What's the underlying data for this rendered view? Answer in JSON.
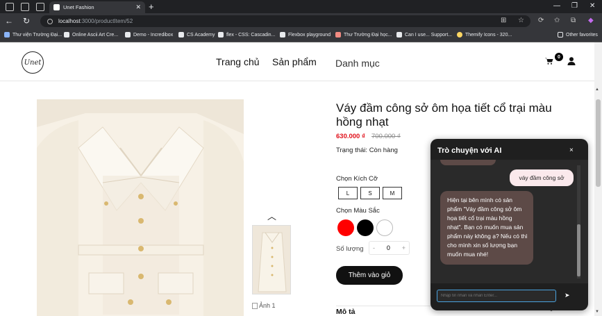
{
  "browser": {
    "tab_title": "Unet Fashion",
    "url_host": "localhost",
    "url_path": ":3000/productItem/52",
    "bookmarks": [
      "Thư viện Trường Đại...",
      "Online Ascii Art Cre...",
      "Demo - Incredibox",
      "CS Academy",
      "flex - CSS: Cascadin...",
      "Flexbox playground",
      "Thư Trường Đại học...",
      "Can I use... Support...",
      "Themify Icons - 320..."
    ],
    "other_favorites": "Other favorites"
  },
  "header": {
    "logo_text": "Unet",
    "nav": [
      "Trang chủ",
      "Sản phẩm",
      "Danh mục"
    ],
    "cart_count": "0"
  },
  "product": {
    "title": "Váy đầm công sở ôm họa tiết cổ trại màu hồng nhạt",
    "price": "630.000 ₫",
    "old_price": "700.000 ₫",
    "status": "Trạng thái: Còn hàng",
    "size_label": "Chọn Kích Cỡ",
    "sizes": [
      "L",
      "S",
      "M"
    ],
    "color_label": "Chọn Màu Sắc",
    "colors": [
      "#ff0000",
      "#000000",
      "#ffffff"
    ],
    "qty_label": "Số lượng",
    "qty_value": "0",
    "qty_minus": "-",
    "qty_plus": "+",
    "add_to_cart": "Thêm vào giỏ",
    "thumb_alt": "Ảnh 1",
    "description_label": "Mô tả"
  },
  "chat": {
    "title": "Trò chuyện với AI",
    "close": "×",
    "user_message": "váy đầm công sở",
    "bot_message": "Hiện tại bên mình có sản phẩm \"Váy đầm công sở ôm họa tiết cổ trại màu hồng nhạt\". Bạn có muốn mua sản phẩm này không ạ? Nếu có thì cho mình xin số lượng bạn muốn mua nhé!",
    "input_placeholder": "Nhập tin nhắn và nhấn Enter...",
    "send": "➤"
  }
}
